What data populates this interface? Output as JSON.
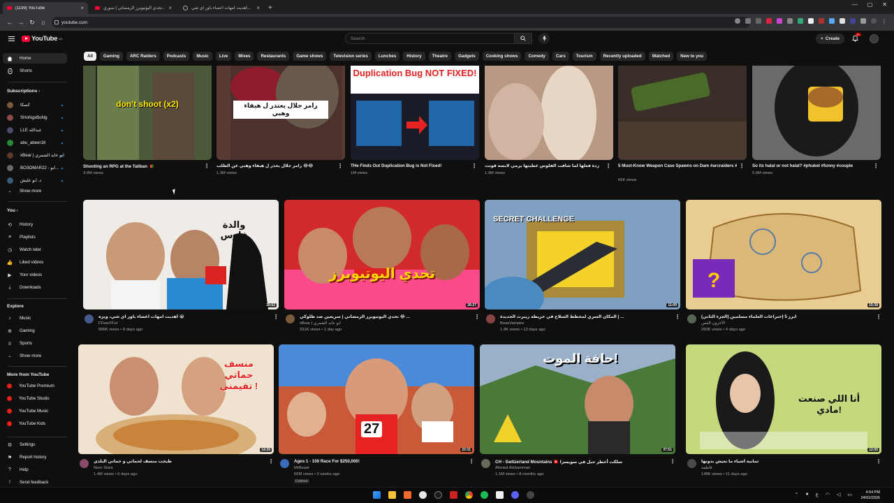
{
  "browser": {
    "tabs": [
      {
        "title": "(1199) YouTube",
        "active": true
      },
      {
        "title": "تحدي اليوتيوبرز الرمضاني | سوري...",
        "active": false
      },
      {
        "title": "أهديت امهات اعضاء باور اي شي...",
        "active": false
      }
    ],
    "url": "youtube.com"
  },
  "header": {
    "logo_text": "YouTube",
    "logo_region": "AE",
    "search_placeholder": "Search",
    "create_label": "Create",
    "notif_count": "9+"
  },
  "chips": [
    "All",
    "Gaming",
    "ARC Raiders",
    "Podcasts",
    "Music",
    "Live",
    "Mixes",
    "Restaurants",
    "Game shows",
    "Television series",
    "Lunches",
    "History",
    "Theatre",
    "Gadgets",
    "Cooking shows",
    "Comedy",
    "Cars",
    "Tourism",
    "Recently uploaded",
    "Watched",
    "New to you"
  ],
  "sidebar": {
    "home": "Home",
    "shorts": "Shorts",
    "subscriptions_heading": "Subscriptions",
    "subscriptions": [
      {
        "name": "كسكا",
        "color": "#7a5a3a"
      },
      {
        "name": "SHoNgxBoNg",
        "color": "#8a4a4a"
      },
      {
        "name": "LLE عبدالله",
        "color": "#4a4a6a"
      },
      {
        "name": "abu_abeer16",
        "color": "#2a8a3a"
      },
      {
        "name": "xBear | ابو عابد الشمري",
        "color": "#5a3a2a"
      },
      {
        "name": "BO3OMAR22 - ابو...",
        "color": "#6a6a6a"
      },
      {
        "name": "د. أبو عليش",
        "color": "#3a5a7a"
      }
    ],
    "show_more": "Show more",
    "you_heading": "You",
    "you_items": [
      "History",
      "Playlists",
      "Watch later",
      "Liked videos",
      "Your videos",
      "Downloads"
    ],
    "explore_heading": "Explore",
    "explore_items": [
      "Music",
      "Gaming",
      "Sports"
    ],
    "explore_show_more": "Show more",
    "more_heading": "More from YouTube",
    "more_items": [
      "YouTube Premium",
      "YouTube Studio",
      "YouTube Music",
      "YouTube Kids"
    ],
    "footer_items": [
      "Settings",
      "Report history",
      "Help",
      "Send feedback"
    ]
  },
  "row1": [
    {
      "title": "Shooting an RPG at the Taliban 🇦🇫",
      "views": "3.6M views",
      "thumb_text": "don't shoot (x2)"
    },
    {
      "title": "رامز جلال يحذر ل هيفاء وهبي عن الطلب 😂😂",
      "views": "1.3M views",
      "thumb_text": "رامز جلال يعتذر ل هيفاء وهبي"
    },
    {
      "title": "THe Finds Out Duplication Bug is Not Fixed!",
      "views": "1M views",
      "thumb_text": "Duplication Bug NOT FIXED!"
    },
    {
      "title": "ردة فعلها لما شافت الفلوس عطيتها يرمي لابسة قوتت",
      "views": "1.9M views",
      "thumb_text": ""
    },
    {
      "title": "5 Must-Know Weapon Case Spawns on Dam #arcraiders #newplayer #tips",
      "views": "66K views",
      "thumb_text": ""
    },
    {
      "title": "So its halal or not halal? #phuket #funny #couple",
      "views": "5.6M views",
      "thumb_text": ""
    }
  ],
  "row2": [
    {
      "title": "أهديت امهات اعضاء باور اي شي، ويزه 😭",
      "channel": "FFearFFul",
      "meta": "896K views • 8 days ago",
      "duration": "20:52",
      "thumb_text": "والدة فارس"
    },
    {
      "title": "تحدي اليوتيوبرز الرمضاني | سريعين ضد طلوكي 😂 ...",
      "channel": "xBear | ابو عابد الشمري",
      "meta": "331K views • 1 day ago",
      "duration": "26:27",
      "thumb_text": "تحدي اليوتيوبرز"
    },
    {
      "title": "المكان السري لمخطط السلاح في خريطة ريبرث الجديدة | ...",
      "channel": "BoasVampire",
      "meta": "1.9K views • 13 days ago",
      "duration": "11:09",
      "thumb_text": "SECRET CHALLENGE"
    },
    {
      "title": "ابرز 5 إختراعات العلماء مسلمين (الجزء الثاني)",
      "channel": "الأحرون القس",
      "meta": "260K views • 4 days ago",
      "duration": "15:38",
      "thumb_text": ""
    }
  ],
  "row3": [
    {
      "title": "طبخت منسف لحماتي و حماتي البلدي",
      "channel": "Noor Stars",
      "meta": "1.4M views • 6 days ago",
      "duration": "14:39",
      "thumb_text": "منسف حماتي تفيمني !"
    },
    {
      "title": "Ages 1 - 100 Race For $250,000!",
      "channel": "MrBeast",
      "meta": "66M views • 2 weeks ago",
      "duration": "23:31",
      "dubbed": "Dubbed",
      "thumb_text": "27"
    },
    {
      "title": "CH - Switzerland Mountains 🇨🇭 سلكت أخطر جبل في سويسرا",
      "channel": "Ahmed Alshammari",
      "meta": "1.1M views • 8 months ago",
      "duration": "37:51",
      "thumb_text": "حافة الموت!"
    },
    {
      "title": "ثمانية أشياء ما نعيش بدونها",
      "channel": "فاطمة",
      "meta": "148K views • 11 days ago",
      "duration": "12:05",
      "thumb_text": "أنا اللي صنعت مادي!"
    }
  ],
  "taskbar": {
    "time": "4:54 PM",
    "date": "24/02/2026",
    "lang": "ع"
  }
}
